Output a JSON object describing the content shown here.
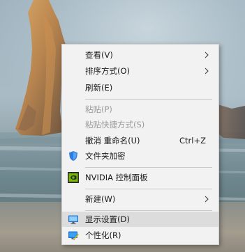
{
  "context_menu": {
    "items": [
      {
        "label": "查看(V)",
        "submenu": true,
        "icon": "",
        "state": "enabled"
      },
      {
        "label": "排序方式(O)",
        "submenu": true,
        "icon": "",
        "state": "enabled"
      },
      {
        "label": "刷新(E)",
        "submenu": false,
        "icon": "",
        "state": "enabled"
      },
      {
        "label": "粘贴(P)",
        "submenu": false,
        "icon": "",
        "state": "disabled"
      },
      {
        "label": "粘贴快捷方式(S)",
        "submenu": false,
        "icon": "",
        "state": "disabled"
      },
      {
        "label": "撤消 重命名(U)",
        "shortcut": "Ctrl+Z",
        "submenu": false,
        "icon": "",
        "state": "enabled"
      },
      {
        "label": "文件夹加密",
        "submenu": false,
        "icon": "shield-icon",
        "state": "enabled"
      },
      {
        "label": "NVIDIA 控制面板",
        "submenu": false,
        "icon": "nvidia-icon",
        "state": "enabled"
      },
      {
        "label": "新建(W)",
        "submenu": true,
        "icon": "",
        "state": "enabled"
      },
      {
        "label": "显示设置(D)",
        "submenu": false,
        "icon": "display-icon",
        "state": "hovered"
      },
      {
        "label": "个性化(R)",
        "submenu": false,
        "icon": "personalize-icon",
        "state": "enabled"
      }
    ]
  },
  "colors": {
    "menu_bg": "#f2f2f2",
    "highlight_bg": "#dcdcdc",
    "disabled_text": "#9b9b9b"
  }
}
